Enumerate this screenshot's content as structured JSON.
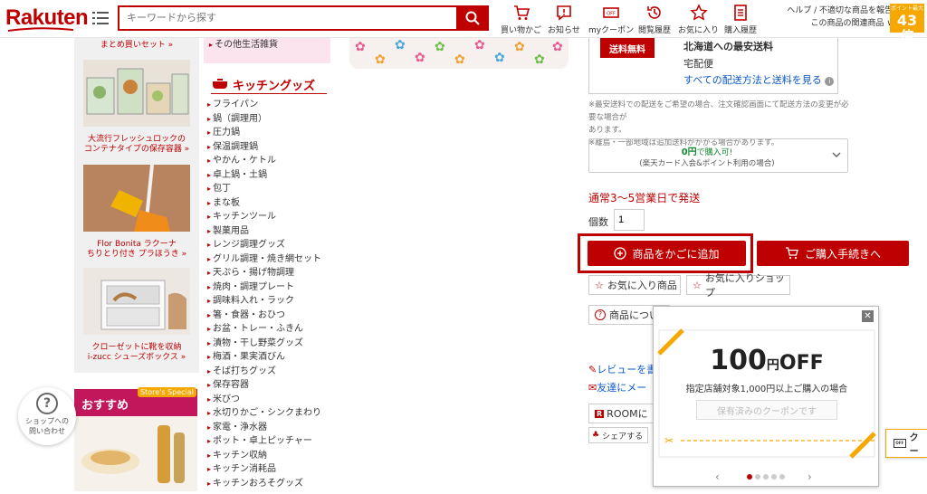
{
  "header": {
    "logo_text": "Rakuten",
    "search_placeholder": "キーワードから探す",
    "nav": [
      {
        "label": "買い物かご"
      },
      {
        "label": "お知らせ"
      },
      {
        "label": "myクーポン"
      },
      {
        "label": "閲覧履歴"
      },
      {
        "label": "お気に入り"
      },
      {
        "label": "購入履歴"
      }
    ],
    "help_line1": "ヘルプ / 不適切な商品を報告",
    "help_line2": "この商品の関連商品 ∨",
    "points_small": "ポイント最大",
    "points_big": "43倍"
  },
  "left_col": {
    "top_link": "まとめ買いセット »",
    "banners": [
      {
        "caption1": "大流行フレッシュロックの",
        "caption2": "コンテナタイプの保存容器 »"
      },
      {
        "caption1": "Flor Bonita ラクーナ",
        "caption2": "ちりとり付き プラほうき »"
      },
      {
        "caption1": "クローゼットに靴を収納",
        "caption2": "i-zucc シューズボックス »"
      }
    ],
    "recommend_title": "おすすめ",
    "recommend_badge": "Store's Special"
  },
  "categories": {
    "top_item": "その他生活雑貨",
    "heading": "キッチングッズ",
    "items": [
      "フライパン",
      "鍋（調理用）",
      "圧力鍋",
      "保温調理鍋",
      "やかん・ケトル",
      "卓上鍋・土鍋",
      "包丁",
      "まな板",
      "キッチンツール",
      "製菓用品",
      "レンジ調理グッズ",
      "グリル調理・焼き網セット",
      "天ぷら・揚げ物調理",
      "焼肉・調理プレート",
      "調味料入れ・ラック",
      "箸・食器・おひつ",
      "お盆・トレー・ふきん",
      "漬物・干し野菜グッズ",
      "梅酒・果実酒びん",
      "そば打ちグッズ",
      "保存容器",
      "米びつ",
      "水切りかご・シンクまわり",
      "家電・浄水器",
      "ポット・卓上ピッチャー",
      "キッチン収納",
      "キッチン消耗品",
      "キッチンおろそグッズ"
    ]
  },
  "shipping": {
    "badge": "送料無料",
    "title": "北海道への最安送料",
    "method": "宅配便",
    "link": "すべての配送方法と送料を見る",
    "note1": "※最安送料での配送をご希望の場合、注文確認画面にて配送方法の変更が必要な場合が",
    "note2": "あります。",
    "note3": "※離島・一部地域は追加送料がかかる場合があります。"
  },
  "card_offer": {
    "amount": "0円",
    "suffix": "で購入可!",
    "sub": "(楽天カード入会&ポイント利用の場合)"
  },
  "purchase": {
    "ship_time": "通常3〜5営業日で発送",
    "qty_label": "個数",
    "qty_value": "1",
    "add_cart": "商品をかごに追加",
    "checkout": "ご購入手続きへ",
    "fav_item": "お気に入り商品",
    "fav_shop": "お気に入りショップ",
    "inquiry": "商品につい",
    "review": "レビューを書",
    "friend": "友達にメー",
    "room": "ROOMに",
    "share": "シェアする"
  },
  "coupon": {
    "amount": "100",
    "unit": "円",
    "off": "OFF",
    "condition": "指定店舗対象1,000円以上ご購入の場合",
    "saved_btn": "保有済みのクーポンです",
    "side_tab": "クー"
  },
  "help_bubble": {
    "line1": "ショップへの",
    "line2": "問い合わせ"
  },
  "colors": {
    "brand": "#bf0000",
    "accent_orange": "#f6a800"
  }
}
